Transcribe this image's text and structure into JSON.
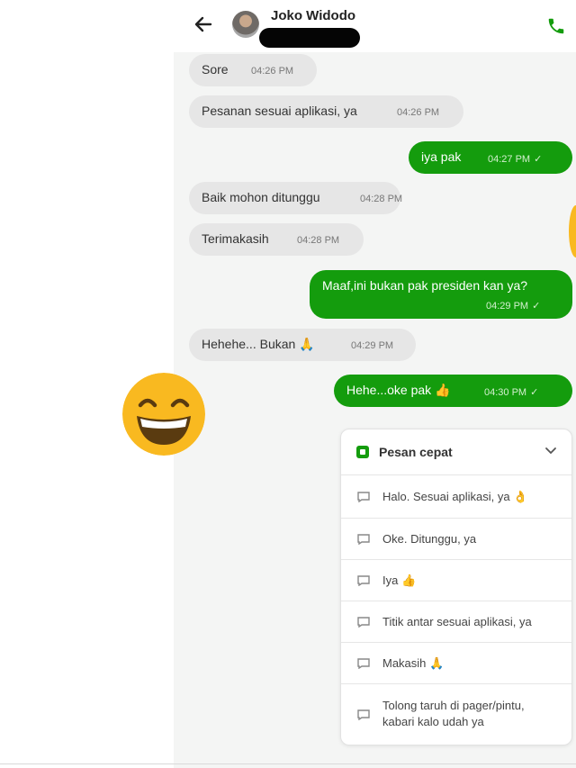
{
  "header": {
    "contact_name": "Joko Widodo",
    "back_icon": "arrow-left-icon",
    "call_icon": "phone-icon"
  },
  "colors": {
    "outgoing_bubble": "#149c0d",
    "incoming_bubble": "#e6e6e6",
    "chat_background": "#f4f5f4",
    "emoji_yellow": "#f9b920"
  },
  "messages": [
    {
      "direction": "in",
      "text": "Sore",
      "time": "04:26 PM"
    },
    {
      "direction": "in",
      "text": "Pesanan sesuai aplikasi, ya",
      "time": "04:26 PM"
    },
    {
      "direction": "out",
      "text": "iya pak",
      "time": "04:27 PM"
    },
    {
      "direction": "in",
      "text": "Baik mohon ditunggu",
      "time": "04:28 PM"
    },
    {
      "direction": "in",
      "text": "Terimakasih",
      "time": "04:28 PM"
    },
    {
      "direction": "out",
      "text": "Maaf,ini bukan pak presiden kan ya?",
      "time": "04:29 PM"
    },
    {
      "direction": "in",
      "text": "Hehehe... Bukan 🙏",
      "time": "04:29 PM"
    },
    {
      "direction": "out",
      "text": "Hehe...oke pak 👍",
      "time": "04:30 PM"
    }
  ],
  "sticker": {
    "icon": "grinning-face-emoji"
  },
  "quick_replies": {
    "title": "Pesan cepat",
    "items": [
      "Halo. Sesuai aplikasi, ya 👌",
      "Oke. Ditunggu, ya",
      "Iya 👍",
      "Titik antar sesuai aplikasi, ya",
      "Makasih 🙏",
      "Tolong taruh di pager/pintu, kabari kalo udah ya"
    ]
  }
}
